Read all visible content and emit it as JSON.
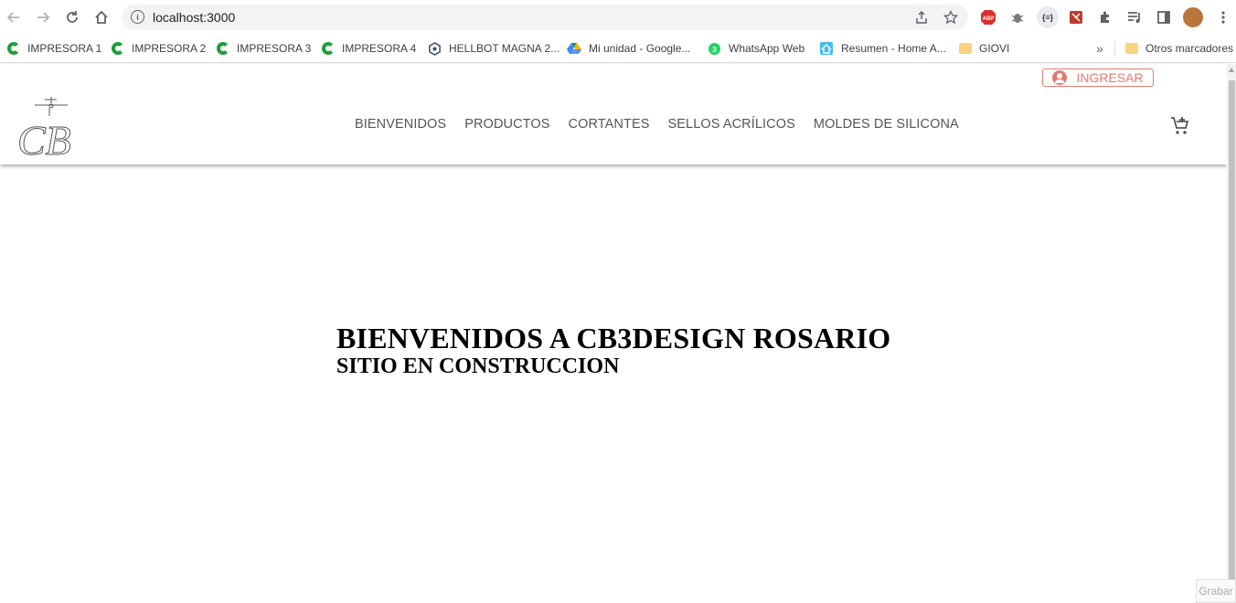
{
  "browser": {
    "url": "localhost:3000",
    "bookmarks": [
      {
        "label": "IMPRESORA 1",
        "icon": "printer-green-icon"
      },
      {
        "label": "IMPRESORA 2",
        "icon": "printer-green-icon"
      },
      {
        "label": "IMPRESORA 3",
        "icon": "printer-green-icon"
      },
      {
        "label": "IMPRESORA 4",
        "icon": "printer-green-icon"
      },
      {
        "label": "HELLBOT MAGNA 2...",
        "icon": "hellbot-icon"
      },
      {
        "label": "Mi unidad - Google...",
        "icon": "google-drive-icon"
      },
      {
        "label": "WhatsApp Web",
        "icon": "whatsapp-icon"
      },
      {
        "label": "Resumen - Home A...",
        "icon": "home-assistant-icon"
      },
      {
        "label": "GIOVI",
        "icon": "folder-icon"
      }
    ],
    "other_bookmarks": "Otros marcadores",
    "whatsapp_badge": "3",
    "abp_label": "ABP"
  },
  "site": {
    "login_label": "INGRESAR",
    "nav": [
      "BIENVENIDOS",
      "PRODUCTOS",
      "CORTANTES",
      "SELLOS ACRÍLICOS",
      "MOLDES DE SILICONA"
    ],
    "logo_text": "CB",
    "hero_title": "BIENVENIDOS A CB3DESIGN ROSARIO",
    "hero_subtitle": "SITIO EN CONSTRUCCION",
    "accent_color": "#e07b70"
  },
  "overlay": {
    "grabar_label": "Grabar"
  }
}
